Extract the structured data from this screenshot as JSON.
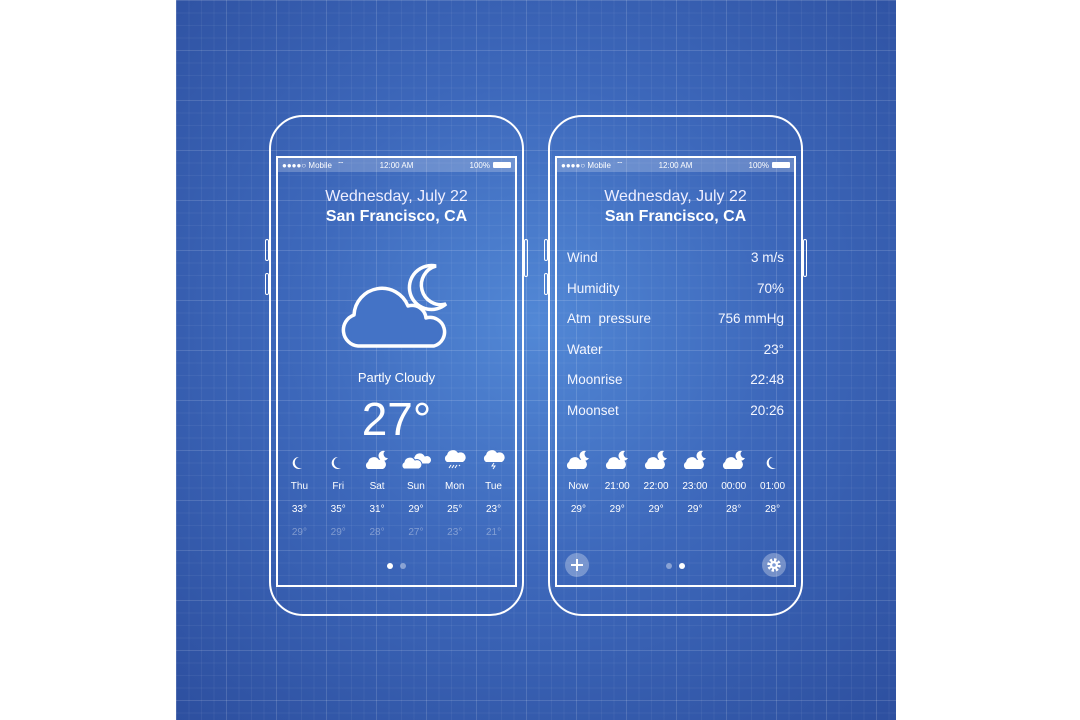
{
  "status": {
    "signal": "●●●●○",
    "carrier": "Mobile",
    "time": "12:00 AM",
    "battery": "100%"
  },
  "header": {
    "date": "Wednesday, July 22",
    "city": "San Francisco, CA"
  },
  "screen1": {
    "icon": "cloud-moon-icon",
    "condition": "Partly Cloudy",
    "temperature": "27°",
    "days": [
      {
        "icon": "moon-icon",
        "label": "Thu",
        "high": "33°",
        "low": "29°"
      },
      {
        "icon": "moon-icon",
        "label": "Fri",
        "high": "35°",
        "low": "29°"
      },
      {
        "icon": "cloud-moon-icon",
        "label": "Sat",
        "high": "31°",
        "low": "28°"
      },
      {
        "icon": "clouds-icon",
        "label": "Sun",
        "high": "29°",
        "low": "27°"
      },
      {
        "icon": "rain-cloud-icon",
        "label": "Mon",
        "high": "25°",
        "low": "23°"
      },
      {
        "icon": "storm-cloud-icon",
        "label": "Tue",
        "high": "23°",
        "low": "21°"
      }
    ],
    "active_page": 1,
    "pages": 2
  },
  "screen2": {
    "details": [
      {
        "label": "Wind",
        "value": "3 m/s"
      },
      {
        "label": "Humidity",
        "value": "70%"
      },
      {
        "label": "Atm  pressure",
        "value": "756 mmHg"
      },
      {
        "label": "Water",
        "value": "23°"
      },
      {
        "label": "Moonrise",
        "value": "22:48"
      },
      {
        "label": "Moonset",
        "value": "20:26"
      }
    ],
    "hours": [
      {
        "icon": "cloud-moon-icon",
        "label": "Now",
        "temp": "29°"
      },
      {
        "icon": "cloud-moon-icon",
        "label": "21:00",
        "temp": "29°"
      },
      {
        "icon": "cloud-moon-icon",
        "label": "22:00",
        "temp": "29°"
      },
      {
        "icon": "cloud-moon-icon",
        "label": "23:00",
        "temp": "29°"
      },
      {
        "icon": "cloud-moon-icon",
        "label": "00:00",
        "temp": "28°"
      },
      {
        "icon": "moon-icon",
        "label": "01:00",
        "temp": "28°"
      }
    ],
    "active_page": 2,
    "pages": 2,
    "add_icon": "plus-icon",
    "settings_icon": "gear-icon"
  }
}
